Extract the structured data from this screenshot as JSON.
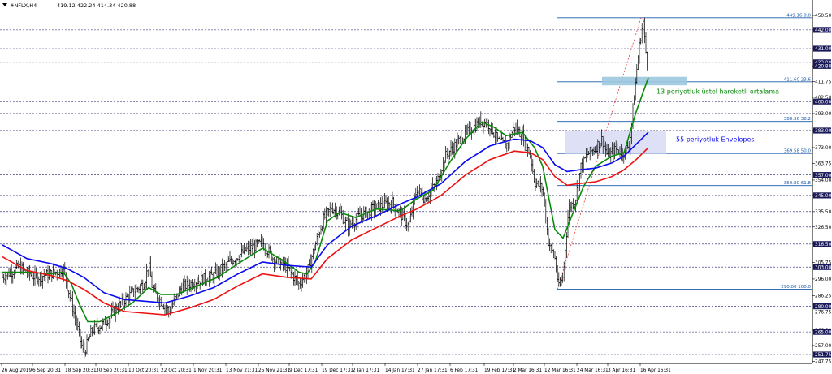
{
  "header": {
    "symbol": "#NFLX,H4",
    "ohlc": "419.12 422.24 414.34 420.88"
  },
  "chart_data": {
    "type": "line",
    "title": "#NFLX,H4",
    "ylim": [
      246.0,
      455.0
    ],
    "y_ticks": [
      247.75,
      257.0,
      266.0,
      276.75,
      286.25,
      296.0,
      305.75,
      316.5,
      326.5,
      335.5,
      345.0,
      354.0,
      363.75,
      373.0,
      383.0,
      393.0,
      402.5,
      411.75,
      420.88,
      431.0,
      442.0,
      450.5
    ],
    "y_tick_labels": [
      "247.75",
      "257.00",
      "266.00",
      "276.75",
      "286.25",
      "296.00",
      "305.75",
      "316.50",
      "326.50",
      "335.50",
      "345.00",
      "354.00",
      "363.75",
      "373.00",
      "383.00",
      "393.00",
      "402.50",
      "411.75",
      "420.88",
      "431.00",
      "442.00",
      "450.50"
    ],
    "highlighted_y_labels": [
      {
        "value": 442.0,
        "label": "442.00"
      },
      {
        "value": 431.0,
        "label": "431.00"
      },
      {
        "value": 423.0,
        "label": "423.00"
      },
      {
        "value": 420.88,
        "label": "420.88"
      },
      {
        "value": 400.0,
        "label": "400.00"
      },
      {
        "value": 383.0,
        "label": "383.00"
      },
      {
        "value": 357.0,
        "label": "357.00"
      },
      {
        "value": 345.0,
        "label": "345.00"
      },
      {
        "value": 316.5,
        "label": "316.50"
      },
      {
        "value": 303.0,
        "label": "303.00"
      },
      {
        "value": 280.0,
        "label": "280.00"
      },
      {
        "value": 265.0,
        "label": "265.00"
      },
      {
        "value": 251.75,
        "label": "251.75"
      }
    ],
    "horizontal_levels": [
      442.0,
      431.0,
      423.0,
      400.0,
      393.0,
      383.0,
      357.0,
      345.0,
      335.5,
      326.5,
      316.5,
      303.0,
      280.0,
      265.0,
      251.75
    ],
    "x_tick_labels": [
      "26 Aug 2019",
      "6 Sep 20:31",
      "18 Sep 20:31",
      "30 Sep 20:31",
      "10 Oct 20:31",
      "22 Oct 20:31",
      "1 Nov 20:31",
      "13 Nov 21:31",
      "25 Nov 21:31",
      "9 Dec 17:31",
      "19 Dec 17:31",
      "2 Jan 17:31",
      "14 Jan 17:31",
      "27 Jan 17:31",
      "6 Feb 17:31",
      "19 Feb 17:31",
      "2 Mar 16:31",
      "12 Mar 16:31",
      "24 Mar 16:31",
      "3 Apr 16:31",
      "16 Apr 16:31"
    ],
    "price_path": [
      [
        0,
        297
      ],
      [
        20,
        303
      ],
      [
        40,
        297
      ],
      [
        60,
        299
      ],
      [
        75,
        302
      ],
      [
        85,
        282
      ],
      [
        95,
        262
      ],
      [
        100,
        252
      ],
      [
        110,
        266
      ],
      [
        125,
        270
      ],
      [
        140,
        279
      ],
      [
        160,
        288
      ],
      [
        175,
        294
      ],
      [
        180,
        305
      ],
      [
        185,
        289
      ],
      [
        195,
        283
      ],
      [
        205,
        277
      ],
      [
        220,
        291
      ],
      [
        240,
        295
      ],
      [
        260,
        298
      ],
      [
        280,
        306
      ],
      [
        300,
        313
      ],
      [
        320,
        317
      ],
      [
        335,
        307
      ],
      [
        350,
        303
      ],
      [
        365,
        293
      ],
      [
        375,
        300
      ],
      [
        385,
        316
      ],
      [
        395,
        331
      ],
      [
        405,
        338
      ],
      [
        415,
        335
      ],
      [
        425,
        327
      ],
      [
        440,
        333
      ],
      [
        460,
        338
      ],
      [
        480,
        341
      ],
      [
        500,
        327
      ],
      [
        510,
        349
      ],
      [
        520,
        343
      ],
      [
        535,
        353
      ],
      [
        545,
        368
      ],
      [
        560,
        376
      ],
      [
        575,
        383
      ],
      [
        590,
        389
      ],
      [
        600,
        386
      ],
      [
        610,
        377
      ],
      [
        620,
        374
      ],
      [
        630,
        385
      ],
      [
        640,
        380
      ],
      [
        650,
        368
      ],
      [
        655,
        353
      ],
      [
        665,
        349
      ],
      [
        672,
        318
      ],
      [
        680,
        308
      ],
      [
        685,
        290
      ],
      [
        690,
        298
      ],
      [
        697,
        338
      ],
      [
        705,
        342
      ],
      [
        712,
        362
      ],
      [
        720,
        369
      ],
      [
        730,
        373
      ],
      [
        738,
        378
      ],
      [
        745,
        368
      ],
      [
        755,
        372
      ],
      [
        765,
        370
      ],
      [
        772,
        376
      ],
      [
        778,
        405
      ],
      [
        782,
        425
      ],
      [
        786,
        440
      ],
      [
        789,
        447
      ],
      [
        791,
        432
      ],
      [
        793,
        426
      ],
      [
        795,
        421
      ]
    ],
    "series": [
      {
        "name": "13 periyotluk üstel hareketli ortalama",
        "color": "#0a8a0a",
        "values": [
          [
            0,
            300
          ],
          [
            30,
            300
          ],
          [
            60,
            299
          ],
          [
            75,
            300
          ],
          [
            85,
            293
          ],
          [
            95,
            281
          ],
          [
            105,
            271
          ],
          [
            120,
            271
          ],
          [
            140,
            276
          ],
          [
            160,
            282
          ],
          [
            180,
            291
          ],
          [
            195,
            287
          ],
          [
            215,
            287
          ],
          [
            240,
            292
          ],
          [
            265,
            297
          ],
          [
            290,
            305
          ],
          [
            320,
            314
          ],
          [
            345,
            307
          ],
          [
            365,
            300
          ],
          [
            375,
            299
          ],
          [
            385,
            306
          ],
          [
            400,
            330
          ],
          [
            415,
            335
          ],
          [
            435,
            332
          ],
          [
            460,
            337
          ],
          [
            490,
            336
          ],
          [
            510,
            343
          ],
          [
            530,
            348
          ],
          [
            550,
            364
          ],
          [
            570,
            378
          ],
          [
            590,
            388
          ],
          [
            605,
            385
          ],
          [
            620,
            380
          ],
          [
            640,
            382
          ],
          [
            655,
            373
          ],
          [
            665,
            362
          ],
          [
            680,
            325
          ],
          [
            690,
            320
          ],
          [
            700,
            332
          ],
          [
            715,
            350
          ],
          [
            730,
            362
          ],
          [
            750,
            368
          ],
          [
            765,
            370
          ],
          [
            780,
            394
          ],
          [
            795,
            414
          ]
        ]
      },
      {
        "name": "55 periyotluk Envelopes",
        "color": "#0a0aee",
        "values": [
          [
            0,
            316
          ],
          [
            30,
            308
          ],
          [
            60,
            305
          ],
          [
            80,
            302
          ],
          [
            100,
            297
          ],
          [
            125,
            288
          ],
          [
            150,
            284
          ],
          [
            175,
            283
          ],
          [
            200,
            282
          ],
          [
            230,
            286
          ],
          [
            260,
            291
          ],
          [
            290,
            299
          ],
          [
            320,
            306
          ],
          [
            350,
            304
          ],
          [
            380,
            303
          ],
          [
            400,
            316
          ],
          [
            430,
            327
          ],
          [
            460,
            333
          ],
          [
            490,
            340
          ],
          [
            510,
            344
          ],
          [
            540,
            352
          ],
          [
            570,
            365
          ],
          [
            600,
            374
          ],
          [
            630,
            378
          ],
          [
            650,
            377
          ],
          [
            665,
            373
          ],
          [
            680,
            363
          ],
          [
            695,
            359
          ],
          [
            710,
            360
          ],
          [
            730,
            361
          ],
          [
            750,
            364
          ],
          [
            765,
            368
          ],
          [
            780,
            375
          ],
          [
            795,
            382
          ]
        ]
      },
      {
        "name": "",
        "color": "#ee1111",
        "values": [
          [
            0,
            309
          ],
          [
            30,
            301
          ],
          [
            60,
            298
          ],
          [
            80,
            295
          ],
          [
            100,
            290
          ],
          [
            125,
            282
          ],
          [
            150,
            277
          ],
          [
            175,
            276
          ],
          [
            200,
            275
          ],
          [
            230,
            279
          ],
          [
            260,
            284
          ],
          [
            290,
            292
          ],
          [
            320,
            299
          ],
          [
            350,
            297
          ],
          [
            380,
            296
          ],
          [
            400,
            308
          ],
          [
            430,
            319
          ],
          [
            460,
            326
          ],
          [
            490,
            333
          ],
          [
            510,
            337
          ],
          [
            540,
            345
          ],
          [
            570,
            357
          ],
          [
            600,
            366
          ],
          [
            630,
            371
          ],
          [
            650,
            370
          ],
          [
            665,
            366
          ],
          [
            680,
            356
          ],
          [
            695,
            351
          ],
          [
            710,
            352
          ],
          [
            730,
            353
          ],
          [
            750,
            356
          ],
          [
            765,
            360
          ],
          [
            780,
            366
          ],
          [
            795,
            373
          ]
        ]
      }
    ],
    "fibonacci": {
      "color": "#1a5aa8",
      "levels": [
        {
          "label": "449.16 0.0",
          "value": 449.16
        },
        {
          "label": "411.60 23.6",
          "value": 411.6
        },
        {
          "label": "388.36 38.2",
          "value": 388.36
        },
        {
          "label": "369.58 50.0",
          "value": 369.58
        },
        {
          "label": "350.80 61.8",
          "value": 350.8
        },
        {
          "label": "290.00 100.0",
          "value": 290.0
        }
      ]
    },
    "annotations": [
      {
        "text": "13 periyotluk üstel hareketli ortalama",
        "color": "#0a8a0a"
      },
      {
        "text": "55 periyotluk Envelopes",
        "color": "#0a0aee"
      }
    ]
  }
}
